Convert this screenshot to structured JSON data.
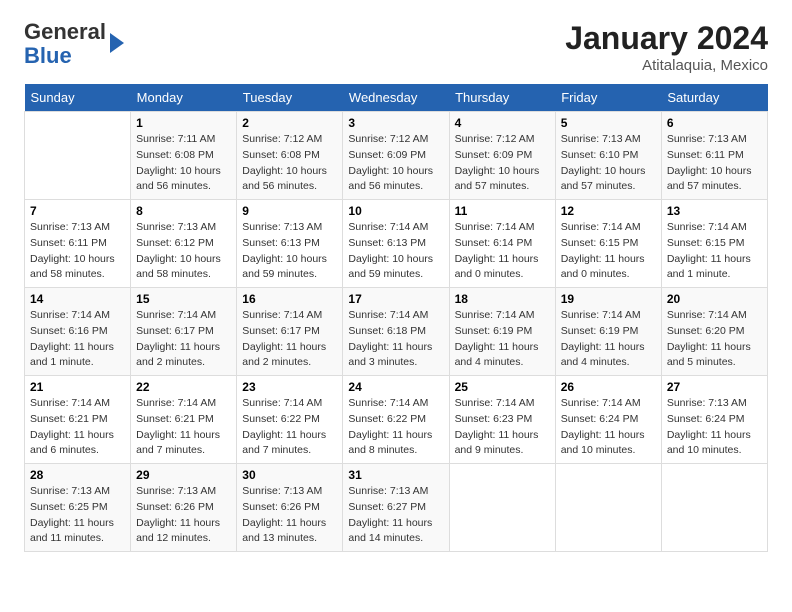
{
  "header": {
    "logo_line1": "General",
    "logo_line2": "Blue",
    "month": "January 2024",
    "location": "Atitalaquia, Mexico"
  },
  "weekdays": [
    "Sunday",
    "Monday",
    "Tuesday",
    "Wednesday",
    "Thursday",
    "Friday",
    "Saturday"
  ],
  "weeks": [
    [
      {
        "num": "",
        "sunrise": "",
        "sunset": "",
        "daylight": ""
      },
      {
        "num": "1",
        "sunrise": "Sunrise: 7:11 AM",
        "sunset": "Sunset: 6:08 PM",
        "daylight": "Daylight: 10 hours and 56 minutes."
      },
      {
        "num": "2",
        "sunrise": "Sunrise: 7:12 AM",
        "sunset": "Sunset: 6:08 PM",
        "daylight": "Daylight: 10 hours and 56 minutes."
      },
      {
        "num": "3",
        "sunrise": "Sunrise: 7:12 AM",
        "sunset": "Sunset: 6:09 PM",
        "daylight": "Daylight: 10 hours and 56 minutes."
      },
      {
        "num": "4",
        "sunrise": "Sunrise: 7:12 AM",
        "sunset": "Sunset: 6:09 PM",
        "daylight": "Daylight: 10 hours and 57 minutes."
      },
      {
        "num": "5",
        "sunrise": "Sunrise: 7:13 AM",
        "sunset": "Sunset: 6:10 PM",
        "daylight": "Daylight: 10 hours and 57 minutes."
      },
      {
        "num": "6",
        "sunrise": "Sunrise: 7:13 AM",
        "sunset": "Sunset: 6:11 PM",
        "daylight": "Daylight: 10 hours and 57 minutes."
      }
    ],
    [
      {
        "num": "7",
        "sunrise": "Sunrise: 7:13 AM",
        "sunset": "Sunset: 6:11 PM",
        "daylight": "Daylight: 10 hours and 58 minutes."
      },
      {
        "num": "8",
        "sunrise": "Sunrise: 7:13 AM",
        "sunset": "Sunset: 6:12 PM",
        "daylight": "Daylight: 10 hours and 58 minutes."
      },
      {
        "num": "9",
        "sunrise": "Sunrise: 7:13 AM",
        "sunset": "Sunset: 6:13 PM",
        "daylight": "Daylight: 10 hours and 59 minutes."
      },
      {
        "num": "10",
        "sunrise": "Sunrise: 7:14 AM",
        "sunset": "Sunset: 6:13 PM",
        "daylight": "Daylight: 10 hours and 59 minutes."
      },
      {
        "num": "11",
        "sunrise": "Sunrise: 7:14 AM",
        "sunset": "Sunset: 6:14 PM",
        "daylight": "Daylight: 11 hours and 0 minutes."
      },
      {
        "num": "12",
        "sunrise": "Sunrise: 7:14 AM",
        "sunset": "Sunset: 6:15 PM",
        "daylight": "Daylight: 11 hours and 0 minutes."
      },
      {
        "num": "13",
        "sunrise": "Sunrise: 7:14 AM",
        "sunset": "Sunset: 6:15 PM",
        "daylight": "Daylight: 11 hours and 1 minute."
      }
    ],
    [
      {
        "num": "14",
        "sunrise": "Sunrise: 7:14 AM",
        "sunset": "Sunset: 6:16 PM",
        "daylight": "Daylight: 11 hours and 1 minute."
      },
      {
        "num": "15",
        "sunrise": "Sunrise: 7:14 AM",
        "sunset": "Sunset: 6:17 PM",
        "daylight": "Daylight: 11 hours and 2 minutes."
      },
      {
        "num": "16",
        "sunrise": "Sunrise: 7:14 AM",
        "sunset": "Sunset: 6:17 PM",
        "daylight": "Daylight: 11 hours and 2 minutes."
      },
      {
        "num": "17",
        "sunrise": "Sunrise: 7:14 AM",
        "sunset": "Sunset: 6:18 PM",
        "daylight": "Daylight: 11 hours and 3 minutes."
      },
      {
        "num": "18",
        "sunrise": "Sunrise: 7:14 AM",
        "sunset": "Sunset: 6:19 PM",
        "daylight": "Daylight: 11 hours and 4 minutes."
      },
      {
        "num": "19",
        "sunrise": "Sunrise: 7:14 AM",
        "sunset": "Sunset: 6:19 PM",
        "daylight": "Daylight: 11 hours and 4 minutes."
      },
      {
        "num": "20",
        "sunrise": "Sunrise: 7:14 AM",
        "sunset": "Sunset: 6:20 PM",
        "daylight": "Daylight: 11 hours and 5 minutes."
      }
    ],
    [
      {
        "num": "21",
        "sunrise": "Sunrise: 7:14 AM",
        "sunset": "Sunset: 6:21 PM",
        "daylight": "Daylight: 11 hours and 6 minutes."
      },
      {
        "num": "22",
        "sunrise": "Sunrise: 7:14 AM",
        "sunset": "Sunset: 6:21 PM",
        "daylight": "Daylight: 11 hours and 7 minutes."
      },
      {
        "num": "23",
        "sunrise": "Sunrise: 7:14 AM",
        "sunset": "Sunset: 6:22 PM",
        "daylight": "Daylight: 11 hours and 7 minutes."
      },
      {
        "num": "24",
        "sunrise": "Sunrise: 7:14 AM",
        "sunset": "Sunset: 6:22 PM",
        "daylight": "Daylight: 11 hours and 8 minutes."
      },
      {
        "num": "25",
        "sunrise": "Sunrise: 7:14 AM",
        "sunset": "Sunset: 6:23 PM",
        "daylight": "Daylight: 11 hours and 9 minutes."
      },
      {
        "num": "26",
        "sunrise": "Sunrise: 7:14 AM",
        "sunset": "Sunset: 6:24 PM",
        "daylight": "Daylight: 11 hours and 10 minutes."
      },
      {
        "num": "27",
        "sunrise": "Sunrise: 7:13 AM",
        "sunset": "Sunset: 6:24 PM",
        "daylight": "Daylight: 11 hours and 10 minutes."
      }
    ],
    [
      {
        "num": "28",
        "sunrise": "Sunrise: 7:13 AM",
        "sunset": "Sunset: 6:25 PM",
        "daylight": "Daylight: 11 hours and 11 minutes."
      },
      {
        "num": "29",
        "sunrise": "Sunrise: 7:13 AM",
        "sunset": "Sunset: 6:26 PM",
        "daylight": "Daylight: 11 hours and 12 minutes."
      },
      {
        "num": "30",
        "sunrise": "Sunrise: 7:13 AM",
        "sunset": "Sunset: 6:26 PM",
        "daylight": "Daylight: 11 hours and 13 minutes."
      },
      {
        "num": "31",
        "sunrise": "Sunrise: 7:13 AM",
        "sunset": "Sunset: 6:27 PM",
        "daylight": "Daylight: 11 hours and 14 minutes."
      },
      {
        "num": "",
        "sunrise": "",
        "sunset": "",
        "daylight": ""
      },
      {
        "num": "",
        "sunrise": "",
        "sunset": "",
        "daylight": ""
      },
      {
        "num": "",
        "sunrise": "",
        "sunset": "",
        "daylight": ""
      }
    ]
  ]
}
